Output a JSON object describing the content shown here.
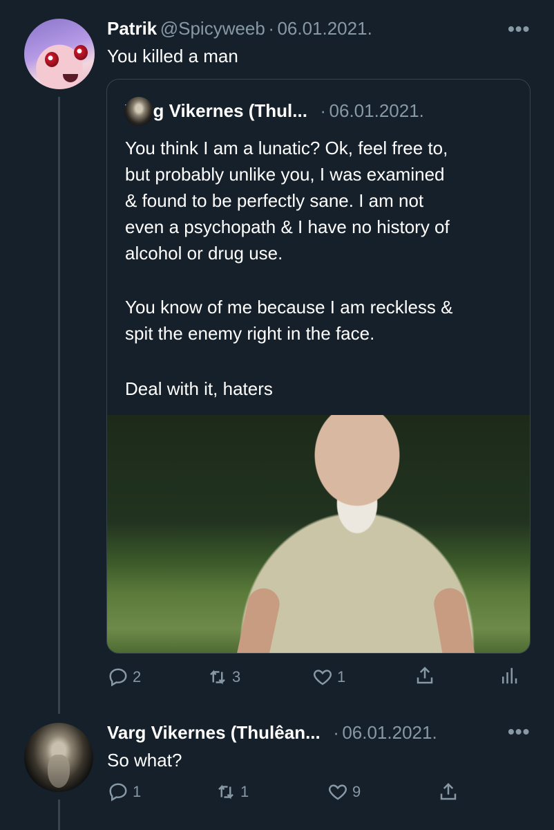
{
  "tweet1": {
    "display_name": "Patrik",
    "handle": "@Spicyweeb",
    "separator": "·",
    "date": "06.01.2021.",
    "text": "You killed a man",
    "more_glyph": "•••"
  },
  "quote": {
    "display_name": "Varg Vikernes (Thul...",
    "separator": "·",
    "date": "06.01.2021.",
    "paragraph1_lines": [
      "You think I am a lunatic? Ok, feel free to,",
      "but probably unlike you, I was examined",
      "& found to be perfectly sane. I am not",
      "even a psychopath & I have no history of",
      "alcohol or drug use."
    ],
    "paragraph2_lines": [
      "You know of me because I am reckless &",
      "spit the enemy right in the face."
    ],
    "paragraph3": "Deal with it, haters"
  },
  "tweet1_actions": {
    "replies": "2",
    "retweets": "3",
    "likes": "1"
  },
  "tweet2": {
    "display_name": "Varg Vikernes (Thulêan...",
    "separator": "·",
    "date": "06.01.2021.",
    "text": "So what?",
    "more_glyph": "•••"
  },
  "tweet2_actions": {
    "replies": "1",
    "retweets": "1",
    "likes": "9"
  },
  "icons": {
    "reply": "reply-icon",
    "retweet": "retweet-icon",
    "like": "heart-icon",
    "share": "share-icon",
    "analytics": "analytics-icon",
    "more": "more-icon"
  },
  "colors": {
    "background": "#15202b",
    "muted": "#8899a6",
    "border": "#38444d"
  }
}
